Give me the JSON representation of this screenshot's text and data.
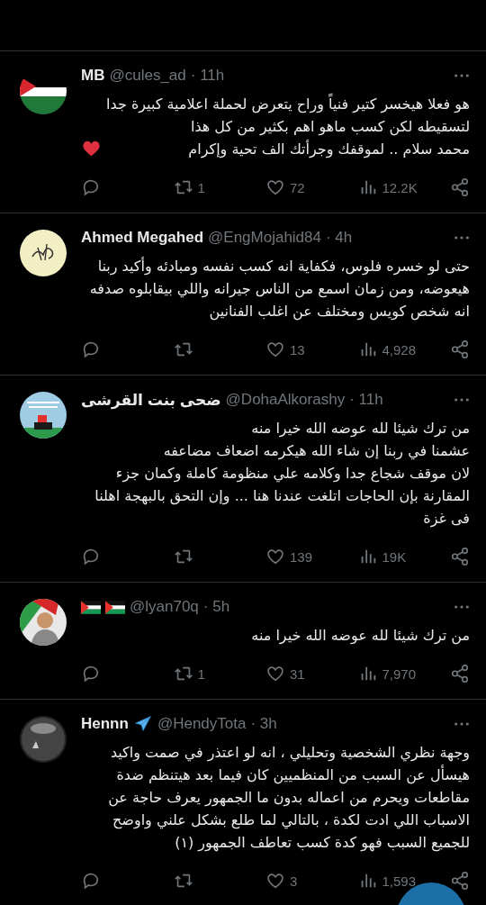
{
  "tweets": [
    {
      "avatar": {
        "kind": "flag"
      },
      "name": "MB",
      "handle": "@cules_ad",
      "time": "· 11h",
      "body": "هو فعلا هيخسر كتير فنياً وراح يتعرض لحملة اعلامية كبيرة جدا\nلتسقيطه لكن كسب ماهو اهم بكثير من كل هذا\nمحمد سلام .. لموقفك وجرأتك الف تحية وإكرام",
      "trailing_icon": {
        "kind": "heart"
      },
      "retweets": "1",
      "likes": "72",
      "views": "12.2K"
    },
    {
      "avatar": {
        "kind": "emblem"
      },
      "name": "Ahmed Megahed",
      "handle": "@EngMojahid84",
      "time": "· 4h",
      "body": "حتى لو خسره فلوس، فكفاية انه كسب نفسه ومبادئه وأكيد ربنا\nهيعوضه، ومن زمان اسمع من الناس جيرانه واللي بيقابلوه صدفه\nانه شخص كويس ومختلف عن اغلب الفنانين",
      "likes": "13",
      "views": "4,928"
    },
    {
      "avatar": {
        "kind": "banner"
      },
      "name": "ضحى بنت القرشى",
      "handle": "@DohaAlkorashy",
      "time": "· 11h",
      "body": "من ترك شيئا لله عوضه الله خيرا منه\nعشمنا في ربنا إن شاء الله هيكرمه اضعاف مضاعفه\nلان موقف شجاع جدا وكلامه علي منظومة كاملة وكمان جزء\nالمقارنة بإن الحاجات اتلغت عندنا هنا ... وإن التحق بالبهجة اهلنا\nفى غزة",
      "likes": "139",
      "views": "19K"
    },
    {
      "avatar": {
        "kind": "figure"
      },
      "name_icons": [
        {
          "kind": "flag"
        },
        {
          "kind": "flag"
        }
      ],
      "handle": "@lyan70q",
      "time": "· 5h",
      "body": "من ترك شيئا لله عوضه الله خيرا منه",
      "retweets": "1",
      "likes": "31",
      "views": "7,970"
    },
    {
      "avatar": {
        "kind": "sphere"
      },
      "name": "Hennn",
      "name_icons": [
        {
          "kind": "plane"
        }
      ],
      "handle": "@HendyTota",
      "time": "· 3h",
      "body": "وجهة نظري الشخصية وتحليلي ، انه لو اعتذر في صمت واكيد\nهيسأل عن السبب من المنظميين كان فيما بعد هيتنظم ضدة\nمقاطعات ويحرم من اعماله بدون ما الجمهور يعرف حاجة عن\nالاسباب اللي ادت لكدة ، بالتالي لما طلع بشكل علني واوضح\nللجميع السبب فهو كدة كسب تعاطف الجمهور (١)",
      "likes": "3",
      "views": "1,593"
    }
  ]
}
